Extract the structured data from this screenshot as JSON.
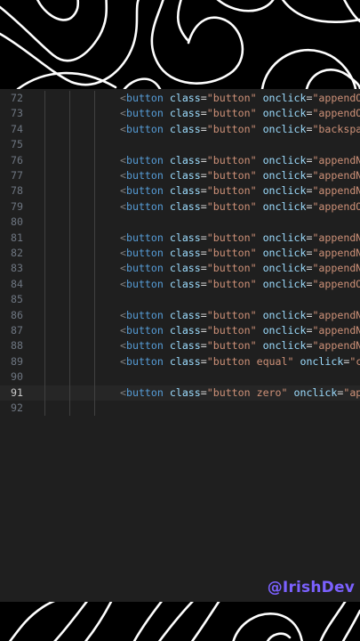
{
  "editor": {
    "lines": [
      {
        "num": "72",
        "tag": "button",
        "attr1": "class",
        "val1": "\"button\"",
        "attr2": "onclick",
        "val2": "\"appendO"
      },
      {
        "num": "73",
        "tag": "button",
        "attr1": "class",
        "val1": "\"button\"",
        "attr2": "onclick",
        "val2": "\"appendO"
      },
      {
        "num": "74",
        "tag": "button",
        "attr1": "class",
        "val1": "\"button\"",
        "attr2": "onclick",
        "val2": "\"backspa"
      },
      {
        "num": "75"
      },
      {
        "num": "76",
        "tag": "button",
        "attr1": "class",
        "val1": "\"button\"",
        "attr2": "onclick",
        "val2": "\"appendN"
      },
      {
        "num": "77",
        "tag": "button",
        "attr1": "class",
        "val1": "\"button\"",
        "attr2": "onclick",
        "val2": "\"appendN"
      },
      {
        "num": "78",
        "tag": "button",
        "attr1": "class",
        "val1": "\"button\"",
        "attr2": "onclick",
        "val2": "\"appendN"
      },
      {
        "num": "79",
        "tag": "button",
        "attr1": "class",
        "val1": "\"button\"",
        "attr2": "onclick",
        "val2": "\"appendO"
      },
      {
        "num": "80"
      },
      {
        "num": "81",
        "tag": "button",
        "attr1": "class",
        "val1": "\"button\"",
        "attr2": "onclick",
        "val2": "\"appendN"
      },
      {
        "num": "82",
        "tag": "button",
        "attr1": "class",
        "val1": "\"button\"",
        "attr2": "onclick",
        "val2": "\"appendN"
      },
      {
        "num": "83",
        "tag": "button",
        "attr1": "class",
        "val1": "\"button\"",
        "attr2": "onclick",
        "val2": "\"appendN"
      },
      {
        "num": "84",
        "tag": "button",
        "attr1": "class",
        "val1": "\"button\"",
        "attr2": "onclick",
        "val2": "\"appendO"
      },
      {
        "num": "85"
      },
      {
        "num": "86",
        "tag": "button",
        "attr1": "class",
        "val1": "\"button\"",
        "attr2": "onclick",
        "val2": "\"appendN"
      },
      {
        "num": "87",
        "tag": "button",
        "attr1": "class",
        "val1": "\"button\"",
        "attr2": "onclick",
        "val2": "\"appendN"
      },
      {
        "num": "88",
        "tag": "button",
        "attr1": "class",
        "val1": "\"button\"",
        "attr2": "onclick",
        "val2": "\"appendN"
      },
      {
        "num": "89",
        "tag": "button",
        "attr1": "class",
        "val1": "\"button equal\"",
        "attr2": "onclick",
        "val2": "\"c"
      },
      {
        "num": "90"
      },
      {
        "num": "91",
        "tag": "button",
        "attr1": "class",
        "val1": "\"button zero\"",
        "attr2": "onclick",
        "val2": "\"ap"
      },
      {
        "num": "92"
      }
    ],
    "active_line": "91"
  },
  "watermark": "@IrishDev",
  "colors": {
    "background": "#1f1f1f",
    "tag": "#569cd6",
    "attribute": "#9cdcfe",
    "string": "#ce9178",
    "line_number": "#6e7681",
    "watermark": "#7b61ff"
  }
}
